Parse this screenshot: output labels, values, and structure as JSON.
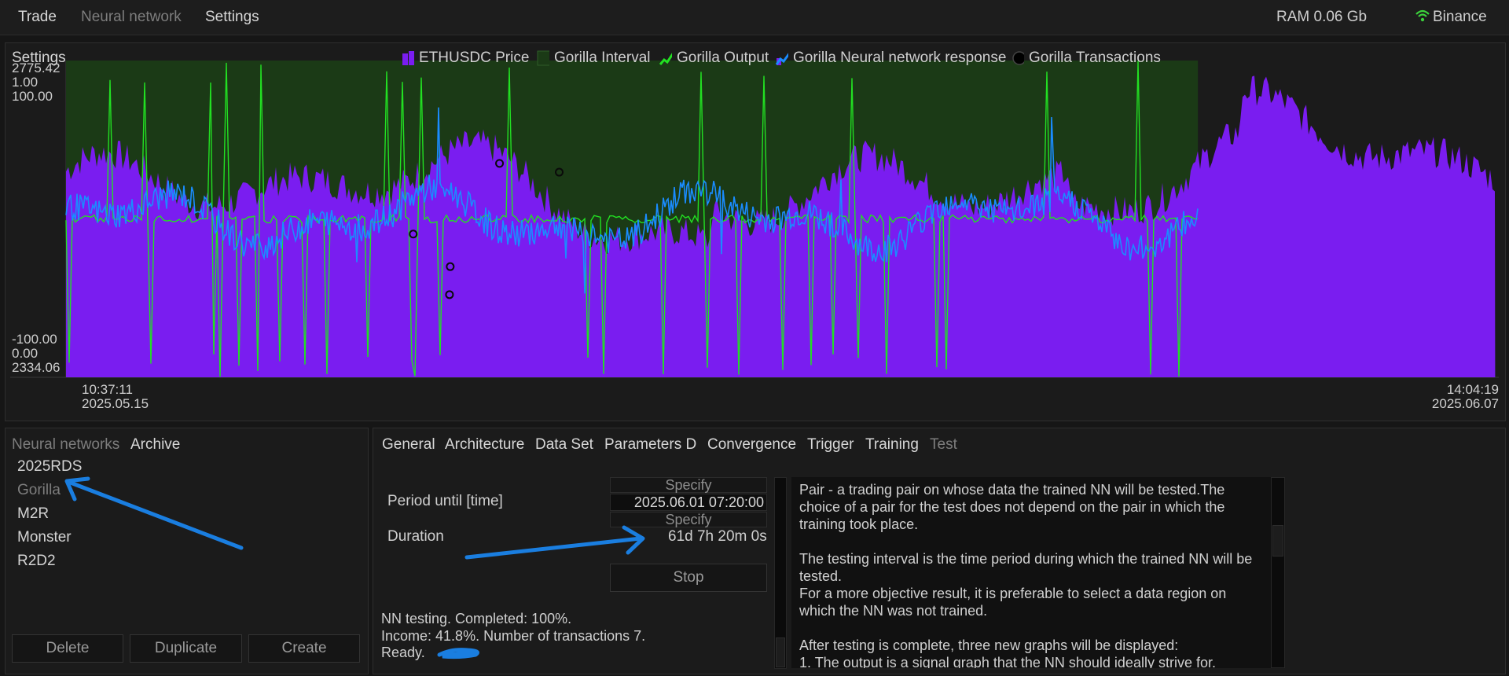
{
  "menu": {
    "trade": "Trade",
    "neural_network": "Neural network",
    "settings": "Settings"
  },
  "status": {
    "ram": "RAM 0.06 Gb",
    "exchange": "Binance"
  },
  "chart_panel": {
    "title": "Settings"
  },
  "chart_data": {
    "type": "area",
    "series": [
      {
        "name": "ETHUSDC Price",
        "color": "#7a1df0",
        "kind": "area"
      },
      {
        "name": "Gorilla Interval",
        "color": "#1b3a16",
        "kind": "band"
      },
      {
        "name": "Gorilla Output",
        "color": "#22e022",
        "kind": "line"
      },
      {
        "name": "Gorilla Neural network response",
        "color": "#1a8cff",
        "kind": "line"
      },
      {
        "name": "Gorilla Transactions",
        "color": "#000000",
        "kind": "marker"
      }
    ],
    "y_labels_top": [
      "2775.42",
      "1.00",
      "100.00"
    ],
    "y_labels_bottom": [
      "-100.00",
      "0.00",
      "2334.06"
    ],
    "x_start": {
      "time": "10:37:11",
      "date": "2025.05.15"
    },
    "x_end": {
      "time": "14:04:19",
      "date": "2025.06.07"
    },
    "price_range": [
      2334.06,
      2775.42
    ],
    "output_range": [
      0.0,
      1.0
    ],
    "response_range": [
      -100.0,
      100.0
    ],
    "interval_fraction": [
      0.0,
      0.79
    ],
    "price_end_fraction": 0.9975,
    "transaction_count": 5
  },
  "left_panel": {
    "tabs": [
      "Neural networks",
      "Archive"
    ],
    "items": [
      "2025RDS",
      "Gorilla",
      "M2R",
      "Monster",
      "R2D2"
    ],
    "buttons": {
      "delete": "Delete",
      "duplicate": "Duplicate",
      "create": "Create"
    }
  },
  "right_panel": {
    "tabs": [
      "General",
      "Architecture",
      "Data Set",
      "Parameters D",
      "Convergence",
      "Trigger",
      "Training",
      "Test"
    ],
    "period_label": "Period until [time]",
    "duration_label": "Duration",
    "specify_top": "Specify",
    "period_value": "2025.06.01 07:20:00",
    "specify_bottom": "Specify",
    "duration_value": "61d 7h 20m 0s",
    "stop_button": "Stop",
    "log": [
      "NN testing. Completed: 100%.",
      "Income: 41.8%. Number of transactions 7.",
      "Ready."
    ],
    "help": [
      "Pair - a trading pair on whose data the trained NN will be tested.The choice of a pair for the test does not depend on the pair in which the training took place.",
      "The testing interval is the time period during which the trained NN will be tested.\nFor a more objective result, it is preferable to select a data region on which the NN was not trained.",
      "After testing is complete, three new graphs will be displayed:\n1. The output is a signal graph that the NN should ideally strive for."
    ]
  },
  "colors": {
    "accent_blue": "#1a7ee0",
    "wifi_green": "#3cd23c"
  }
}
